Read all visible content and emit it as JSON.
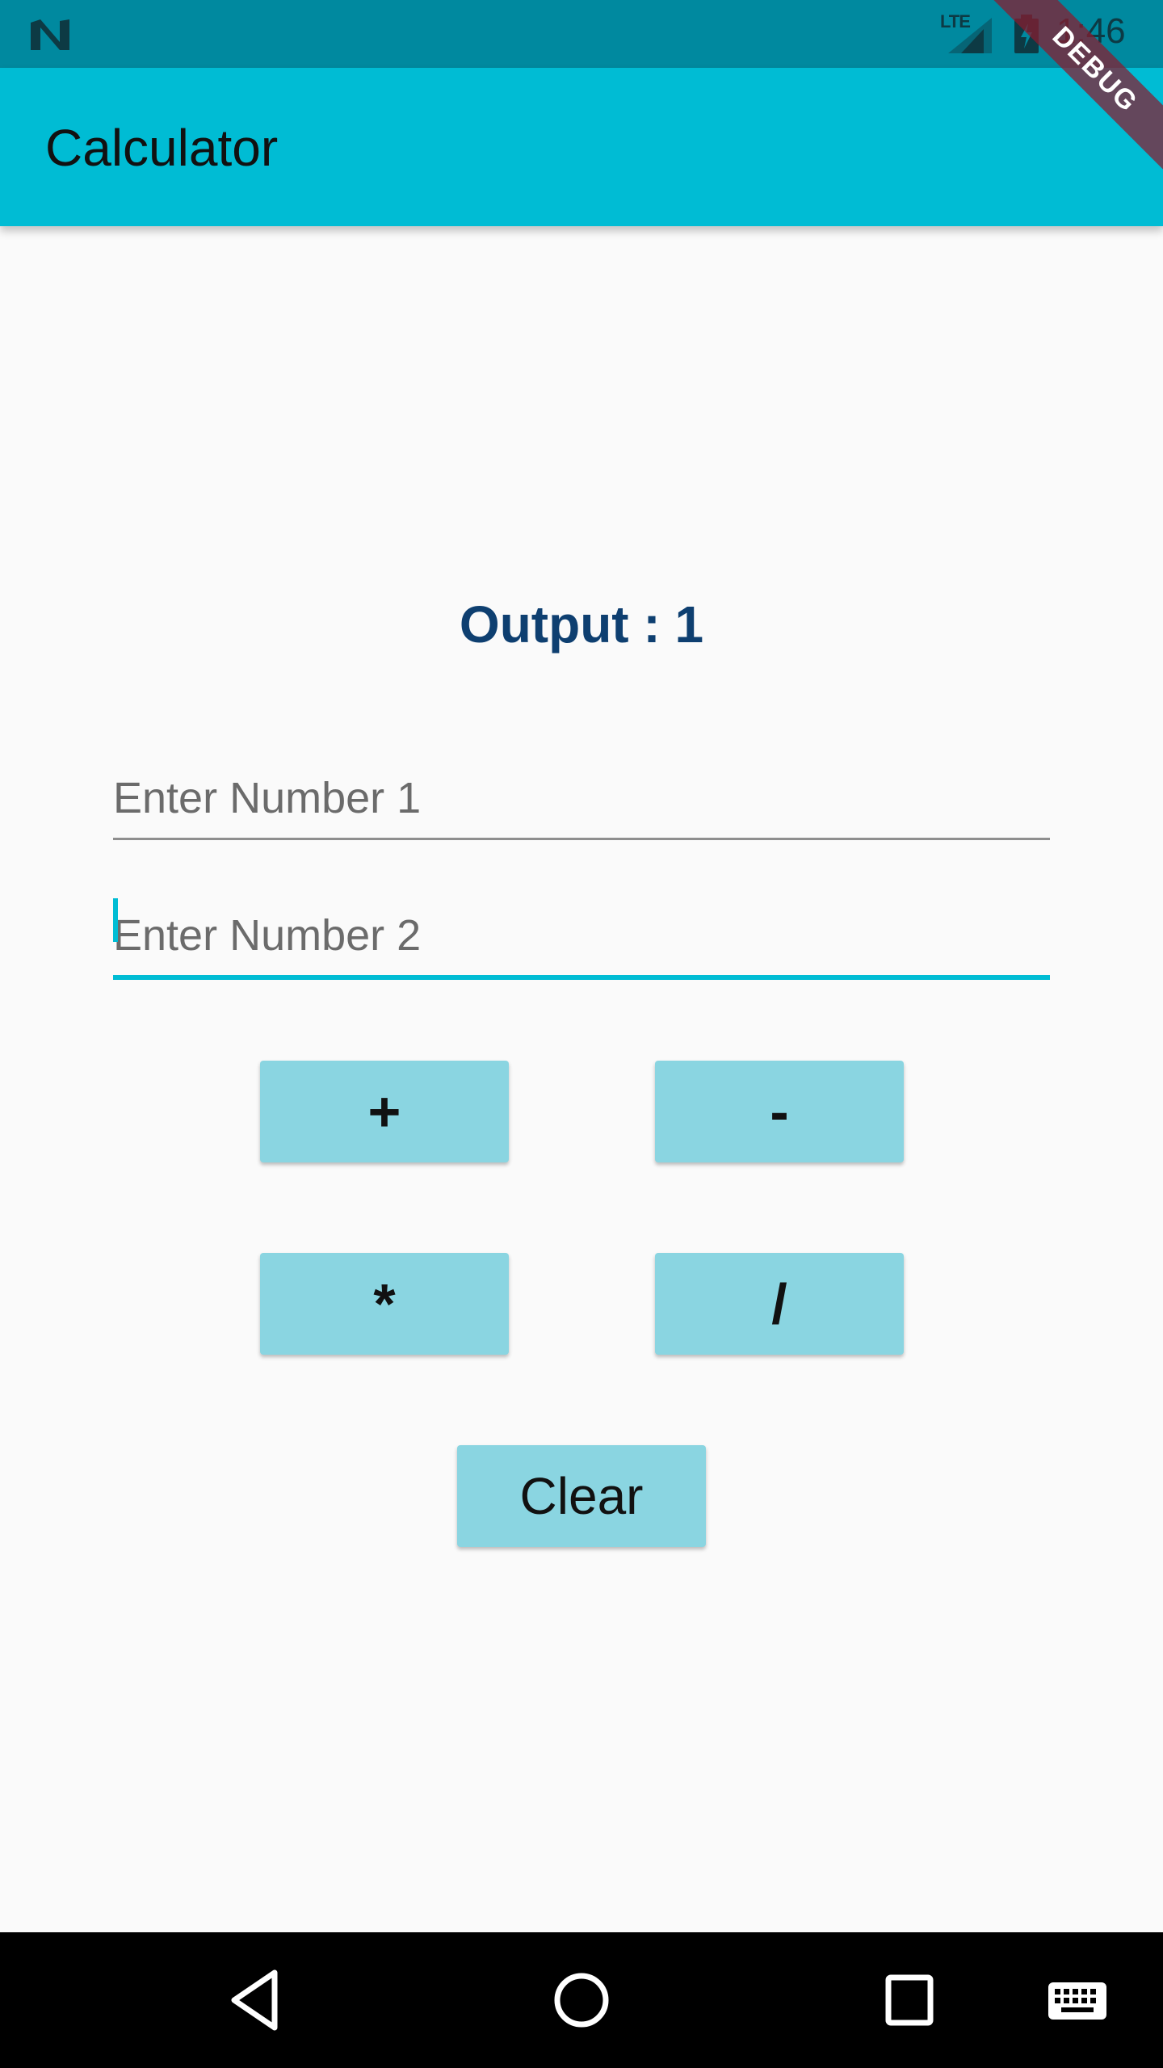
{
  "status_bar": {
    "network_label": "LTE",
    "time": "1:46",
    "icons": [
      "notification-n-icon",
      "signal-icon",
      "battery-charging-icon"
    ]
  },
  "debug_banner": "DEBUG",
  "app_bar": {
    "title": "Calculator"
  },
  "output": {
    "text": "Output : 1"
  },
  "inputs": {
    "number1": {
      "value": "",
      "placeholder": "Enter Number 1"
    },
    "number2": {
      "value": "",
      "placeholder": "Enter Number 2"
    }
  },
  "buttons": {
    "add": "+",
    "subtract": "-",
    "multiply": "*",
    "divide": "/",
    "clear": "Clear"
  },
  "nav_bar": {
    "icons": [
      "back-icon",
      "home-icon",
      "recents-icon",
      "keyboard-icon"
    ]
  },
  "colors": {
    "status_bar": "#00899f",
    "app_bar": "#00bcd4",
    "output_text": "#0e3f70",
    "button_bg": "#8ad5e1",
    "background": "#fafafa"
  }
}
